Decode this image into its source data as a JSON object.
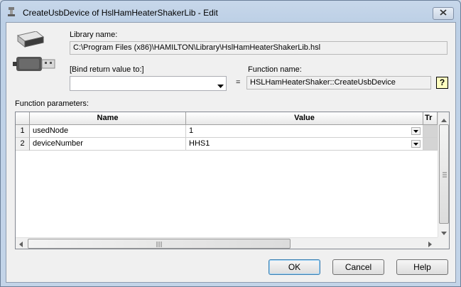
{
  "window": {
    "title": "CreateUsbDevice of HslHamHeaterShakerLib - Edit"
  },
  "library": {
    "label": "Library name:",
    "path": "C:\\Program Files (x86)\\HAMILTON\\Library\\HslHamHeaterShakerLib.hsl"
  },
  "bind": {
    "label": "[Bind return value to:]",
    "value": "",
    "equals": "="
  },
  "function": {
    "label": "Function name:",
    "name": "HSLHamHeaterShaker::CreateUsbDevice",
    "help": "?"
  },
  "params": {
    "label": "Function parameters:",
    "columns": [
      "Name",
      "Value",
      "Tr"
    ],
    "rows": [
      {
        "index": "1",
        "name": "usedNode",
        "value": "1"
      },
      {
        "index": "2",
        "name": "deviceNumber",
        "value": "HHS1"
      }
    ]
  },
  "buttons": {
    "ok": "OK",
    "cancel": "Cancel",
    "help": "Help"
  },
  "icons": {
    "title": "tool-icon",
    "usb": "usb-device-icon",
    "close": "close-icon",
    "help": "help-question-icon",
    "dropdown": "chevron-down-icon"
  }
}
